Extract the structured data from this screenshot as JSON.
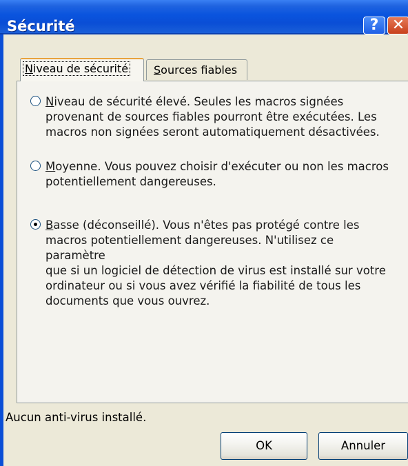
{
  "window": {
    "title": "Sécurité",
    "help_glyph": "?",
    "close_glyph": "✕"
  },
  "tabs": [
    {
      "label": "Niveau de sécurité",
      "active": true
    },
    {
      "label": "Sources fiables",
      "active": false
    }
  ],
  "options": [
    {
      "lines": [
        "Niveau de sécurité élevé. Seules les macros signées",
        "provenant de sources fiables pourront être exécutées. Les",
        "macros non signées seront automatiquement désactivées."
      ],
      "selected": false
    },
    {
      "lines": [
        "Moyenne. Vous pouvez choisir d'exécuter ou non les macros",
        "potentiellement dangereuses."
      ],
      "selected": false
    },
    {
      "lines": [
        "Basse (déconseillé). Vous n'êtes pas protégé contre les",
        "macros potentiellement dangereuses. N'utilisez ce paramètre",
        "que si un logiciel de détection de virus est installé sur votre",
        "ordinateur ou si vous avez vérifié la fiabilité de tous les",
        "documents que vous ouvrez."
      ],
      "selected": true
    }
  ],
  "status": "Aucun anti-virus installé.",
  "buttons": {
    "ok": "OK",
    "cancel": "Annuler"
  },
  "colors": {
    "titlebar": "#0a54de",
    "dialog_bg": "#ece9d8",
    "tab_accent": "#e8a33c"
  }
}
